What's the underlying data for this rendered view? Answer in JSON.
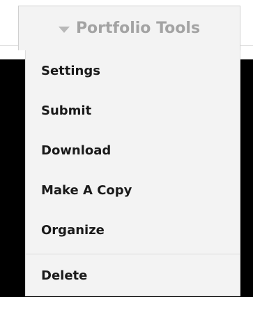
{
  "dropdown": {
    "label": "Portfolio Tools",
    "icon": "chevron-down-icon",
    "items": [
      {
        "label": "Settings"
      },
      {
        "label": "Submit"
      },
      {
        "label": "Download"
      },
      {
        "label": "Make A Copy"
      },
      {
        "label": "Organize"
      }
    ],
    "danger_item": {
      "label": "Delete"
    }
  },
  "colors": {
    "menu_background": "#f3f3f3",
    "trigger_text": "#a3a3a3",
    "item_text": "#1a1a1a",
    "backdrop": "#000000"
  }
}
